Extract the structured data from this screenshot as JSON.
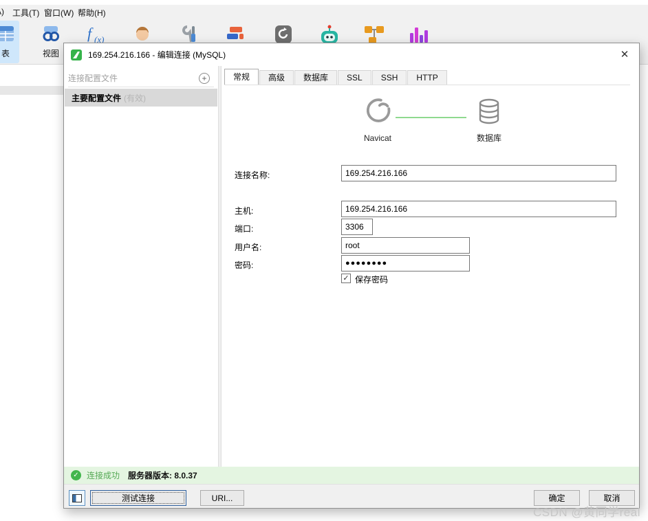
{
  "colors": {
    "accent_green": "#35b34a",
    "status_bar_bg": "#e4f5e1",
    "status_text_green": "#55a955",
    "selected_profile_bg": "#d9d9d9",
    "toolbar_selected_bg": "#cfe7fb",
    "focus_border_blue": "#2d5f9e",
    "connector_line_green": "#8fd98f"
  },
  "menu_bar": {
    "partial_item": "A)",
    "items": [
      "工具(T)",
      "窗口(W)",
      "帮助(H)"
    ]
  },
  "toolbar": {
    "table_label": "表",
    "view_label": "视图"
  },
  "dialog": {
    "title": "169.254.216.166 - 编辑连接 (MySQL)",
    "close_glyph": "✕",
    "sidebar": {
      "header": "连接配置文件",
      "add_glyph": "+",
      "profile_name": "主要配置文件",
      "profile_status": "(有效)"
    },
    "tabs": [
      "常规",
      "高级",
      "数据库",
      "SSL",
      "SSH",
      "HTTP"
    ],
    "hero": {
      "left_label": "Navicat",
      "right_label": "数据库"
    },
    "form": {
      "connection_name": {
        "label": "连接名称:",
        "value": "169.254.216.166"
      },
      "host": {
        "label": "主机:",
        "value": "169.254.216.166"
      },
      "port": {
        "label": "端口:",
        "value": "3306"
      },
      "username": {
        "label": "用户名:",
        "value": "root"
      },
      "password": {
        "label": "密码:",
        "value": "●●●●●●●●"
      },
      "save_password": {
        "label": "保存密码",
        "check_glyph": "✓",
        "checked": true
      }
    },
    "status": {
      "check_glyph": "✓",
      "text": "连接成功",
      "detail": "服务器版本: 8.0.37"
    },
    "footer": {
      "test": "测试连接",
      "uri": "URI...",
      "ok": "确定",
      "cancel": "取消"
    }
  },
  "watermark": "CSDN @黄同学real"
}
